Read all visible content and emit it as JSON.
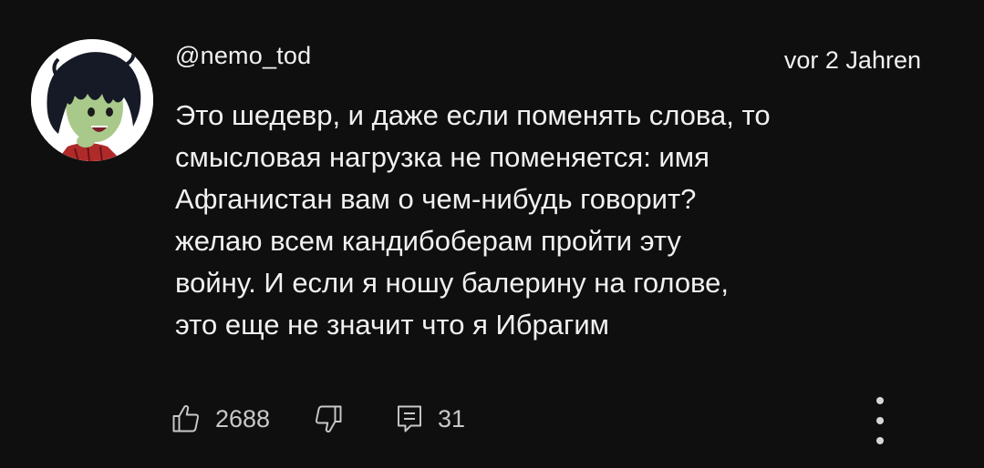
{
  "comment": {
    "author": "@nemo_tod",
    "timestamp": "vor 2 Jahren",
    "text_lines": [
      "Это шедевр, и даже если поменять слова, то",
      "смысловая нагрузка не поменяется: имя",
      "Афганистан вам о чем-нибудь говорит?",
      "желаю всем кандибоберам пройти эту",
      "войну. И если я ношу балерину на голове,",
      "это еще не значит что я Ибрагим"
    ],
    "likes": "2688",
    "replies": "31"
  },
  "colors": {
    "background": "#0f0f0f",
    "text": "#f1f1f1",
    "secondary": "#c8c8c8"
  },
  "icons": {
    "avatar": "avatar-image",
    "like": "thumbs-up-icon",
    "dislike": "thumbs-down-icon",
    "reply": "reply-comment-icon",
    "more": "more-vert-icon"
  }
}
